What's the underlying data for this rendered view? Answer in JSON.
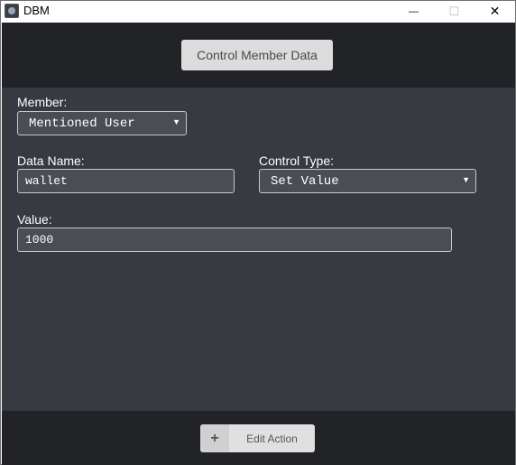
{
  "window": {
    "title": "DBM",
    "minimize_glyph": "—",
    "maximize_glyph": "☐",
    "close_glyph": "✕"
  },
  "header": {
    "button_label": "Control Member Data"
  },
  "form": {
    "member": {
      "label": "Member:",
      "value": "Mentioned User"
    },
    "data_name": {
      "label": "Data Name:",
      "value": "wallet"
    },
    "control_type": {
      "label": "Control Type:",
      "value": "Set Value"
    },
    "value": {
      "label": "Value:",
      "value": "1000"
    },
    "dropdown_glyph": "▼"
  },
  "footer": {
    "plus_glyph": "+",
    "edit_action_label": "Edit Action"
  },
  "colors": {
    "panel_dark": "#222326",
    "content_bg": "#373a40",
    "field_bg": "#4a4d53",
    "button_bg": "#dcdcdc"
  }
}
